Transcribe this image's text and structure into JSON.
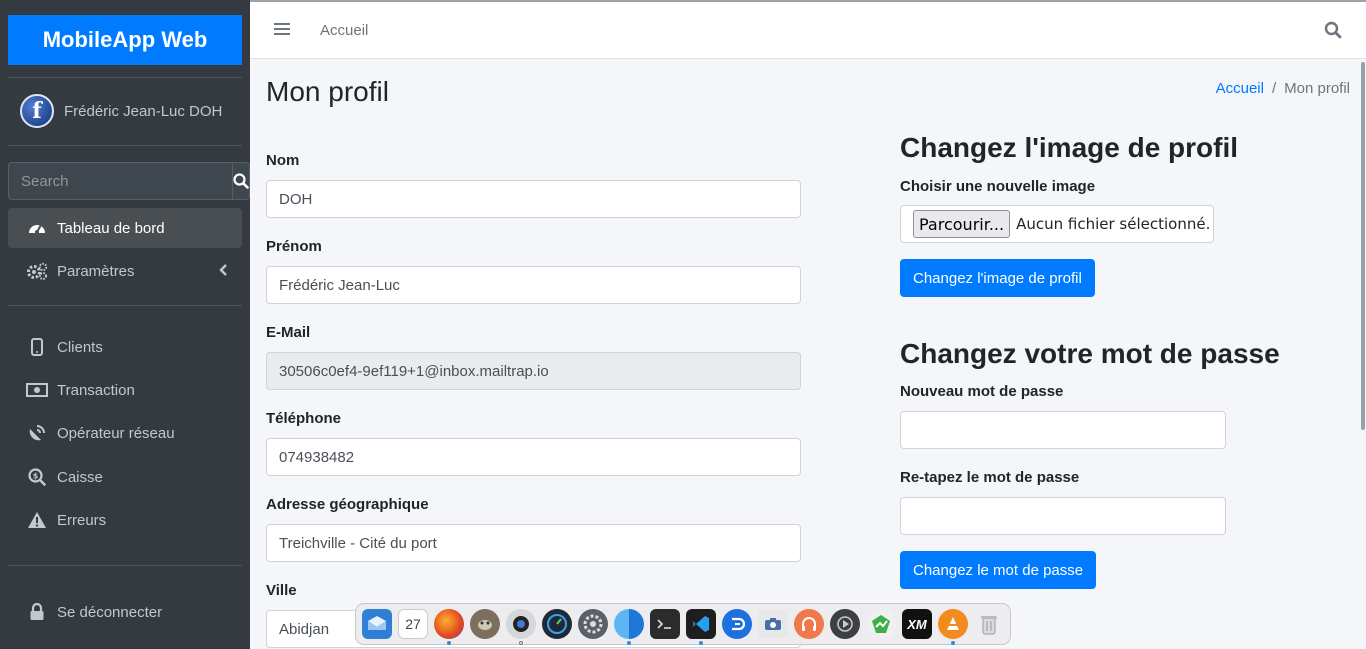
{
  "sidebar": {
    "brand": "MobileApp Web",
    "user_name": "Frédéric Jean-Luc DOH",
    "avatar_letter": "f",
    "search_placeholder": "Search",
    "items": [
      {
        "label": "Tableau de bord",
        "icon": "tachometer-icon",
        "active": true
      },
      {
        "label": "Paramètres",
        "icon": "cogs-icon"
      },
      {
        "label": "Clients",
        "icon": "mobile-icon"
      },
      {
        "label": "Transaction",
        "icon": "money-bill-icon"
      },
      {
        "label": "Opérateur réseau",
        "icon": "satellite-dish-icon"
      },
      {
        "label": "Caisse",
        "icon": "search-dollar-icon"
      },
      {
        "label": "Erreurs",
        "icon": "warning-icon"
      },
      {
        "label": "Se déconnecter",
        "icon": "lock-icon"
      }
    ]
  },
  "topbar": {
    "home_link": "Accueil"
  },
  "page": {
    "title": "Mon profil",
    "breadcrumb": {
      "home": "Accueil",
      "separator": "/",
      "current": "Mon profil"
    }
  },
  "profile_form": {
    "fields": [
      {
        "label": "Nom",
        "value": "DOH"
      },
      {
        "label": "Prénom",
        "value": "Frédéric Jean-Luc"
      },
      {
        "label": "E-Mail",
        "value": "30506c0ef4-9ef119+1@inbox.mailtrap.io",
        "disabled": true
      },
      {
        "label": "Téléphone",
        "value": "074938482"
      },
      {
        "label": "Adresse géographique",
        "value": "Treichville - Cité du port"
      },
      {
        "label": "Ville",
        "value": "Abidjan"
      }
    ]
  },
  "image_section": {
    "title": "Changez l'image de profil",
    "label": "Choisir une nouvelle image",
    "browse_button": "Parcourir...",
    "no_file": "Aucun fichier sélectionné.",
    "submit": "Changez l'image de profil"
  },
  "password_section": {
    "title": "Changez votre mot de passe",
    "new_label": "Nouveau mot de passe",
    "retype_label": "Re-tapez le mot de passe",
    "submit": "Changez le mot de passe"
  },
  "dock": {
    "calendar_day": "27",
    "xm_label": "XM",
    "apps": [
      "mail-icon",
      "calendar-icon",
      "firefox-icon",
      "gimp-icon",
      "camera-lens-icon",
      "speed-gauge-icon",
      "settings-icon",
      "finder-icon",
      "terminal-icon",
      "vscode-icon",
      "discord-like-icon",
      "screenshot-icon",
      "music-icon",
      "media-player-icon",
      "metatrader-icon",
      "xm-icon",
      "vlc-icon",
      "trash-icon"
    ]
  },
  "colors": {
    "sidebar_bg": "#343a40",
    "brand_bg": "#007bff",
    "primary": "#007bff",
    "content_bg": "#f4f6f9"
  }
}
